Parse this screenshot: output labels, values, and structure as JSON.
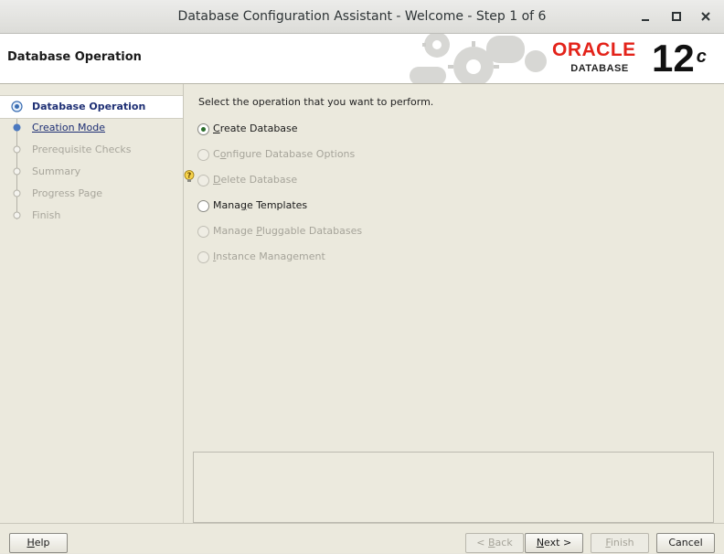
{
  "window": {
    "title": "Database Configuration Assistant - Welcome - Step 1 of 6",
    "controls": [
      "minimize",
      "maximize",
      "close"
    ]
  },
  "header": {
    "title": "Database Operation",
    "brand_word": "ORACLE",
    "brand_sub": "DATABASE",
    "version": "12",
    "version_suffix": "c",
    "brand_color": "#e3231a"
  },
  "steps": [
    {
      "label": "Database Operation",
      "state": "current"
    },
    {
      "label": "Creation Mode",
      "state": "link"
    },
    {
      "label": "Prerequisite Checks",
      "state": "disabled"
    },
    {
      "label": "Summary",
      "state": "disabled"
    },
    {
      "label": "Progress Page",
      "state": "disabled"
    },
    {
      "label": "Finish",
      "state": "disabled"
    }
  ],
  "main": {
    "prompt": "Select the operation that you want to perform.",
    "options": [
      {
        "pre": "",
        "key": "C",
        "post": "reate Database",
        "selected": true,
        "enabled": true
      },
      {
        "pre": "C",
        "key": "o",
        "post": "nfigure Database Options",
        "selected": false,
        "enabled": false
      },
      {
        "pre": "",
        "key": "D",
        "post": "elete Database",
        "selected": false,
        "enabled": false
      },
      {
        "pre": "Mana",
        "key": "g",
        "post": "e Templates",
        "selected": false,
        "enabled": true
      },
      {
        "pre": "Manage ",
        "key": "P",
        "post": "luggable Databases",
        "selected": false,
        "enabled": false
      },
      {
        "pre": "",
        "key": "I",
        "post": "nstance Management",
        "selected": false,
        "enabled": false
      }
    ],
    "message": ""
  },
  "buttons": {
    "help": {
      "pre": "",
      "key": "H",
      "post": "elp"
    },
    "back": {
      "pre": "< ",
      "key": "B",
      "post": "ack"
    },
    "next": {
      "pre": "",
      "key": "N",
      "post": "ext >"
    },
    "finish": {
      "pre": "",
      "key": "F",
      "post": "inish"
    },
    "cancel": {
      "label": "Cancel"
    }
  }
}
